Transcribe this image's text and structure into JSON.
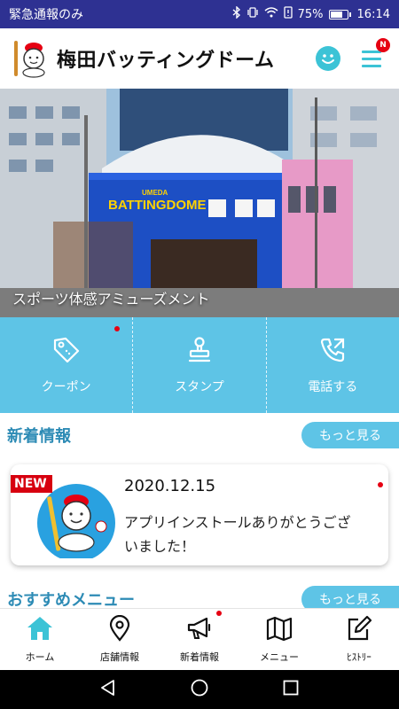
{
  "status_bar": {
    "left_text": "緊急通報のみ",
    "battery": "75%",
    "battery_level": 0.75,
    "time": "16:14"
  },
  "header": {
    "title": "梅田バッティングドーム",
    "menu_badge": "N"
  },
  "hero": {
    "sign_text": "BATTINGDOME",
    "sign_small": "UMEDA",
    "caption": "スポーツ体感アミューズメント"
  },
  "actions": [
    {
      "label": "クーポン",
      "icon": "coupon-tag-icon"
    },
    {
      "label": "スタンプ",
      "icon": "stamp-icon"
    },
    {
      "label": "電話する",
      "icon": "phone-call-icon"
    }
  ],
  "news_section": {
    "title": "新着情報",
    "more_label": "もっと見る"
  },
  "news_card": {
    "badge": "NEW",
    "date": "2020.12.15",
    "text": "アプリインストールありがとうございました！"
  },
  "recommend_section": {
    "title": "おすすめメニュー",
    "more_label": "もっと見る"
  },
  "bottom_nav": [
    {
      "label": "ホーム",
      "icon": "home-icon",
      "active": true
    },
    {
      "label": "店舗情報",
      "icon": "location-pin-icon"
    },
    {
      "label": "新着情報",
      "icon": "megaphone-icon"
    },
    {
      "label": "メニュー",
      "icon": "map-icon"
    },
    {
      "label": "ﾋｽﾄﾘｰ",
      "icon": "edit-icon"
    }
  ],
  "colors": {
    "status_bar": "#2e3192",
    "accent": "#5ec4e6",
    "section_title": "#2d8bb5",
    "active_nav": "#3cc3d6",
    "badge_red": "#e60012"
  }
}
